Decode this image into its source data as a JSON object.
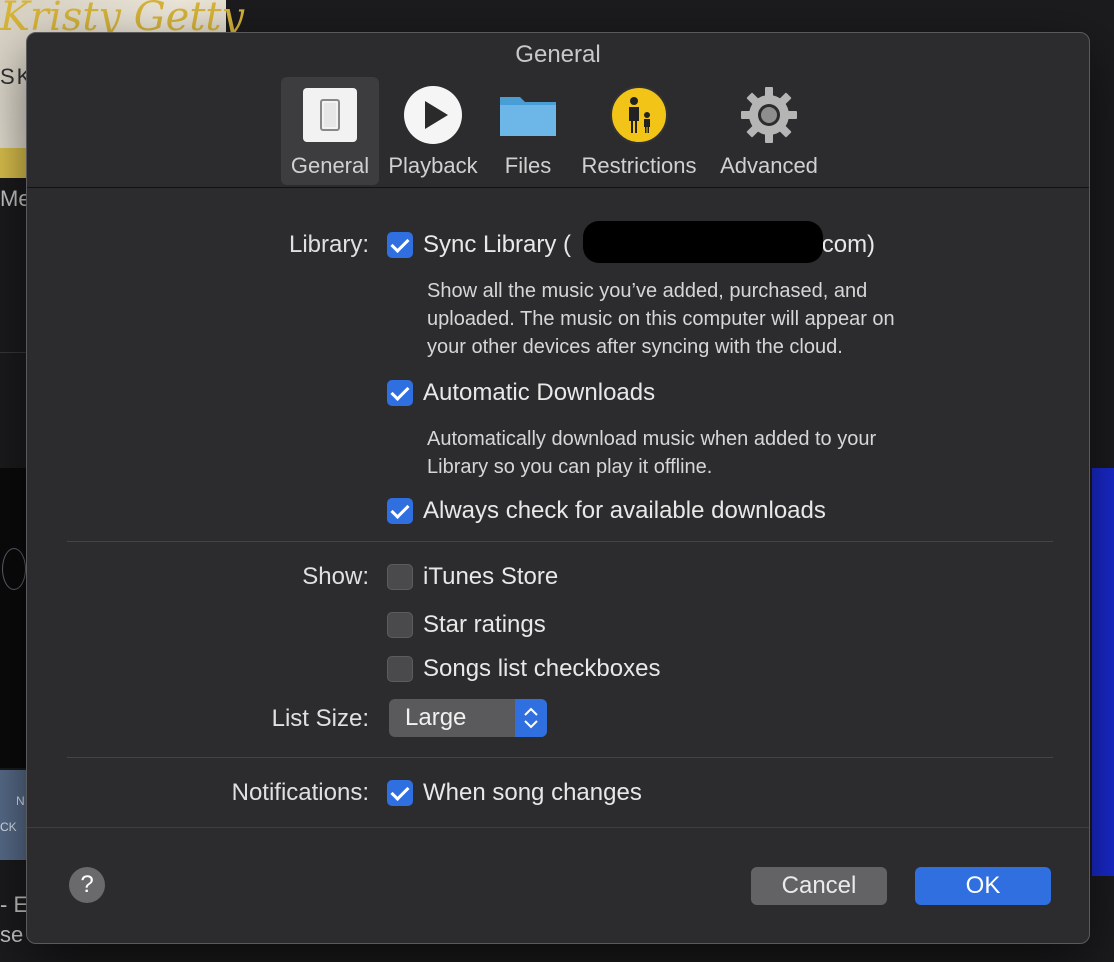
{
  "background": {
    "album_script_text": "Kristy Getty",
    "album_sub_text": "SK",
    "left_label": "Me",
    "bottom_text_line1": "- E",
    "bottom_text_line2": "se",
    "low_album_text1": "N",
    "low_album_text2": "CK"
  },
  "dialog": {
    "title": "General",
    "toolbar": [
      {
        "label": "General",
        "icon": "switch-icon",
        "selected": true
      },
      {
        "label": "Playback",
        "icon": "play-icon",
        "selected": false
      },
      {
        "label": "Files",
        "icon": "folder-icon",
        "selected": false
      },
      {
        "label": "Restrictions",
        "icon": "parental-controls-icon",
        "selected": false
      },
      {
        "label": "Advanced",
        "icon": "gear-icon",
        "selected": false
      }
    ],
    "library": {
      "label": "Library:",
      "sync_library": {
        "text_prefix": "Sync Library (",
        "text_suffix": ".com)",
        "checked": true
      },
      "sync_desc_1": "Show all the music you’ve added, purchased, and",
      "sync_desc_2": "uploaded. The music on this computer will appear on",
      "sync_desc_3": "your other devices after syncing with the cloud.",
      "auto_downloads": {
        "text": "Automatic Downloads",
        "checked": true
      },
      "auto_desc_1": "Automatically download music when added to your",
      "auto_desc_2": "Library so you can play it offline.",
      "always_check": {
        "text": "Always check for available downloads",
        "checked": true
      }
    },
    "show": {
      "label": "Show:",
      "itunes_store": {
        "text": "iTunes Store",
        "checked": false
      },
      "star_ratings": {
        "text": "Star ratings",
        "checked": false
      },
      "songs_checkboxes": {
        "text": "Songs list checkboxes",
        "checked": false
      }
    },
    "list_size": {
      "label": "List Size:",
      "value": "Large"
    },
    "notifications": {
      "label": "Notifications:",
      "when_song_changes": {
        "text": "When song changes",
        "checked": true
      }
    },
    "buttons": {
      "help": "?",
      "cancel": "Cancel",
      "ok": "OK"
    },
    "colors": {
      "accent": "#2f6fe0",
      "dialog_bg": "#2c2c2e",
      "restrictions_yellow": "#f2c418"
    }
  }
}
